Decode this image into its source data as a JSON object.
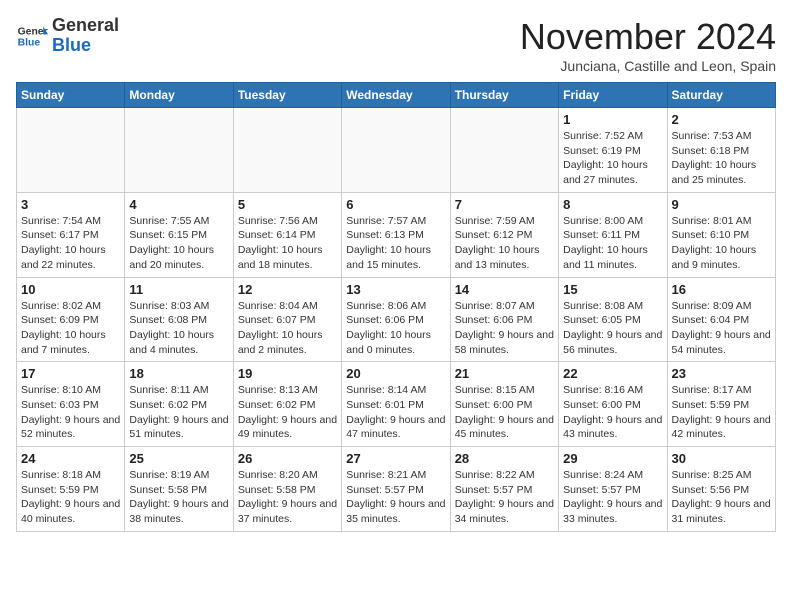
{
  "logo": {
    "general": "General",
    "blue": "Blue"
  },
  "header": {
    "month": "November 2024",
    "location": "Junciana, Castille and Leon, Spain"
  },
  "days_of_week": [
    "Sunday",
    "Monday",
    "Tuesday",
    "Wednesday",
    "Thursday",
    "Friday",
    "Saturday"
  ],
  "weeks": [
    [
      {
        "day": "",
        "info": ""
      },
      {
        "day": "",
        "info": ""
      },
      {
        "day": "",
        "info": ""
      },
      {
        "day": "",
        "info": ""
      },
      {
        "day": "",
        "info": ""
      },
      {
        "day": "1",
        "info": "Sunrise: 7:52 AM\nSunset: 6:19 PM\nDaylight: 10 hours and 27 minutes."
      },
      {
        "day": "2",
        "info": "Sunrise: 7:53 AM\nSunset: 6:18 PM\nDaylight: 10 hours and 25 minutes."
      }
    ],
    [
      {
        "day": "3",
        "info": "Sunrise: 7:54 AM\nSunset: 6:17 PM\nDaylight: 10 hours and 22 minutes."
      },
      {
        "day": "4",
        "info": "Sunrise: 7:55 AM\nSunset: 6:15 PM\nDaylight: 10 hours and 20 minutes."
      },
      {
        "day": "5",
        "info": "Sunrise: 7:56 AM\nSunset: 6:14 PM\nDaylight: 10 hours and 18 minutes."
      },
      {
        "day": "6",
        "info": "Sunrise: 7:57 AM\nSunset: 6:13 PM\nDaylight: 10 hours and 15 minutes."
      },
      {
        "day": "7",
        "info": "Sunrise: 7:59 AM\nSunset: 6:12 PM\nDaylight: 10 hours and 13 minutes."
      },
      {
        "day": "8",
        "info": "Sunrise: 8:00 AM\nSunset: 6:11 PM\nDaylight: 10 hours and 11 minutes."
      },
      {
        "day": "9",
        "info": "Sunrise: 8:01 AM\nSunset: 6:10 PM\nDaylight: 10 hours and 9 minutes."
      }
    ],
    [
      {
        "day": "10",
        "info": "Sunrise: 8:02 AM\nSunset: 6:09 PM\nDaylight: 10 hours and 7 minutes."
      },
      {
        "day": "11",
        "info": "Sunrise: 8:03 AM\nSunset: 6:08 PM\nDaylight: 10 hours and 4 minutes."
      },
      {
        "day": "12",
        "info": "Sunrise: 8:04 AM\nSunset: 6:07 PM\nDaylight: 10 hours and 2 minutes."
      },
      {
        "day": "13",
        "info": "Sunrise: 8:06 AM\nSunset: 6:06 PM\nDaylight: 10 hours and 0 minutes."
      },
      {
        "day": "14",
        "info": "Sunrise: 8:07 AM\nSunset: 6:06 PM\nDaylight: 9 hours and 58 minutes."
      },
      {
        "day": "15",
        "info": "Sunrise: 8:08 AM\nSunset: 6:05 PM\nDaylight: 9 hours and 56 minutes."
      },
      {
        "day": "16",
        "info": "Sunrise: 8:09 AM\nSunset: 6:04 PM\nDaylight: 9 hours and 54 minutes."
      }
    ],
    [
      {
        "day": "17",
        "info": "Sunrise: 8:10 AM\nSunset: 6:03 PM\nDaylight: 9 hours and 52 minutes."
      },
      {
        "day": "18",
        "info": "Sunrise: 8:11 AM\nSunset: 6:02 PM\nDaylight: 9 hours and 51 minutes."
      },
      {
        "day": "19",
        "info": "Sunrise: 8:13 AM\nSunset: 6:02 PM\nDaylight: 9 hours and 49 minutes."
      },
      {
        "day": "20",
        "info": "Sunrise: 8:14 AM\nSunset: 6:01 PM\nDaylight: 9 hours and 47 minutes."
      },
      {
        "day": "21",
        "info": "Sunrise: 8:15 AM\nSunset: 6:00 PM\nDaylight: 9 hours and 45 minutes."
      },
      {
        "day": "22",
        "info": "Sunrise: 8:16 AM\nSunset: 6:00 PM\nDaylight: 9 hours and 43 minutes."
      },
      {
        "day": "23",
        "info": "Sunrise: 8:17 AM\nSunset: 5:59 PM\nDaylight: 9 hours and 42 minutes."
      }
    ],
    [
      {
        "day": "24",
        "info": "Sunrise: 8:18 AM\nSunset: 5:59 PM\nDaylight: 9 hours and 40 minutes."
      },
      {
        "day": "25",
        "info": "Sunrise: 8:19 AM\nSunset: 5:58 PM\nDaylight: 9 hours and 38 minutes."
      },
      {
        "day": "26",
        "info": "Sunrise: 8:20 AM\nSunset: 5:58 PM\nDaylight: 9 hours and 37 minutes."
      },
      {
        "day": "27",
        "info": "Sunrise: 8:21 AM\nSunset: 5:57 PM\nDaylight: 9 hours and 35 minutes."
      },
      {
        "day": "28",
        "info": "Sunrise: 8:22 AM\nSunset: 5:57 PM\nDaylight: 9 hours and 34 minutes."
      },
      {
        "day": "29",
        "info": "Sunrise: 8:24 AM\nSunset: 5:57 PM\nDaylight: 9 hours and 33 minutes."
      },
      {
        "day": "30",
        "info": "Sunrise: 8:25 AM\nSunset: 5:56 PM\nDaylight: 9 hours and 31 minutes."
      }
    ]
  ]
}
